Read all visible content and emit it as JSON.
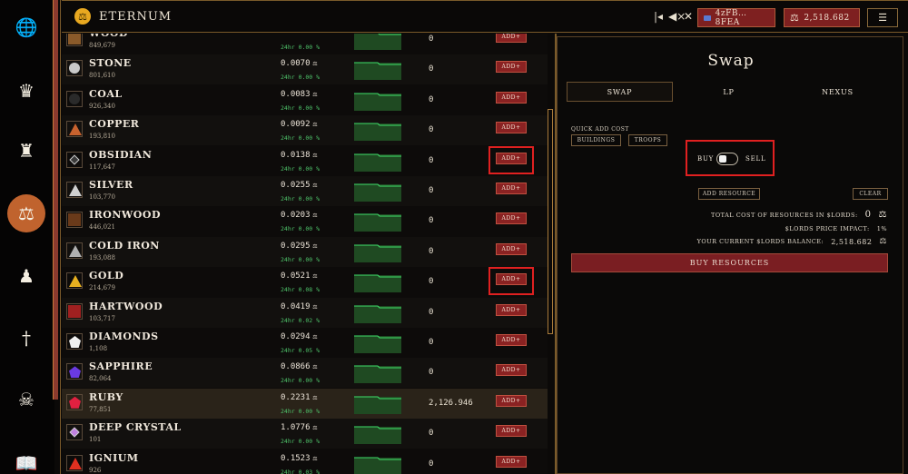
{
  "app": {
    "brand": "ETERNUM"
  },
  "topbar": {
    "back_icon": "skip-back-icon",
    "mute_icon": "mute-icon",
    "close_icon": "close-icon",
    "account": "4zFB…8FEA",
    "balance": "2,518.682"
  },
  "sidebar": {
    "items": [
      {
        "icon": "globe-icon",
        "glyph": "🌐"
      },
      {
        "icon": "crown-icon",
        "glyph": "♛"
      },
      {
        "icon": "castle-icon",
        "glyph": "♜"
      },
      {
        "icon": "scales-icon",
        "glyph": "⚖"
      },
      {
        "icon": "army-icon",
        "glyph": "♟"
      },
      {
        "icon": "sword-icon",
        "glyph": "†"
      },
      {
        "icon": "skull-icon",
        "glyph": "☠"
      },
      {
        "icon": "book-icon",
        "glyph": "📖"
      }
    ]
  },
  "resources": [
    {
      "name": "WOOD",
      "amount": "849,679",
      "price": "",
      "change": "24hr 0.00 %",
      "qty": "0",
      "color": "#8a5a2a",
      "shape": "square"
    },
    {
      "name": "STONE",
      "amount": "801,610",
      "price": "0.0070",
      "change": "24hr 0.00 %",
      "qty": "0",
      "color": "#c9c9c9",
      "shape": "circle"
    },
    {
      "name": "COAL",
      "amount": "926,340",
      "price": "0.0083",
      "change": "24hr 0.00 %",
      "qty": "0",
      "color": "#2a2a2a",
      "shape": "circle"
    },
    {
      "name": "COPPER",
      "amount": "193,810",
      "price": "0.0092",
      "change": "24hr 0.00 %",
      "qty": "0",
      "color": "#c8622e",
      "shape": "triangle"
    },
    {
      "name": "OBSIDIAN",
      "amount": "117,647",
      "price": "0.0138",
      "change": "24hr 0.00 %",
      "qty": "0",
      "color": "#3a3a3a",
      "shape": "diamond"
    },
    {
      "name": "SILVER",
      "amount": "103,770",
      "price": "0.0255",
      "change": "24hr 0.00 %",
      "qty": "0",
      "color": "#d0d0d0",
      "shape": "triangle"
    },
    {
      "name": "IRONWOOD",
      "amount": "446,021",
      "price": "0.0203",
      "change": "24hr 0.00 %",
      "qty": "0",
      "color": "#6a3a1a",
      "shape": "square"
    },
    {
      "name": "COLD IRON",
      "amount": "193,088",
      "price": "0.0295",
      "change": "24hr 0.00 %",
      "qty": "0",
      "color": "#b0b0b0",
      "shape": "triangle"
    },
    {
      "name": "GOLD",
      "amount": "214,679",
      "price": "0.0521",
      "change": "24hr 0.08 %",
      "qty": "0",
      "color": "#e8b020",
      "shape": "triangle"
    },
    {
      "name": "HARTWOOD",
      "amount": "103,717",
      "price": "0.0419",
      "change": "24hr 0.02 %",
      "qty": "0",
      "color": "#a02020",
      "shape": "square"
    },
    {
      "name": "DIAMONDS",
      "amount": "1,108",
      "price": "0.0294",
      "change": "24hr 0.05 %",
      "qty": "0",
      "color": "#f0f0f0",
      "shape": "pentagon"
    },
    {
      "name": "SAPPHIRE",
      "amount": "82,064",
      "price": "0.0866",
      "change": "24hr 0.00 %",
      "qty": "0",
      "color": "#6a3ae0",
      "shape": "gem"
    },
    {
      "name": "RUBY",
      "amount": "77,851",
      "price": "0.2231",
      "change": "24hr 0.00 %",
      "qty": "2,126.946",
      "color": "#e02040",
      "shape": "pentagon"
    },
    {
      "name": "DEEP CRYSTAL",
      "amount": "101",
      "price": "1.0776",
      "change": "24hr 0.00 %",
      "qty": "0",
      "color": "#c080e0",
      "shape": "diamond"
    },
    {
      "name": "IGNIUM",
      "amount": "926",
      "price": "0.1523",
      "change": "24hr 0.03 %",
      "qty": "0",
      "color": "#e03020",
      "shape": "triangle"
    }
  ],
  "labels": {
    "currency_symbol": "⚖",
    "add_btn": "ADD+"
  },
  "swap": {
    "title": "Swap",
    "tabs": [
      "SWAP",
      "LP",
      "NEXUS"
    ],
    "quick_add_label": "QUICK ADD COST",
    "quick_add_buttons": [
      "BUILDINGS",
      "TROOPS"
    ],
    "toggle_buy": "BUY",
    "toggle_sell": "SELL",
    "add_resource": "ADD RESOURCE",
    "clear": "CLEAR",
    "total_cost_label": "TOTAL COST OF RESOURCES IN $LORDS:",
    "total_cost_value": "0",
    "impact_label": "$LORDS PRICE IMPACT:",
    "impact_value": "1%",
    "balance_label": "YOUR CURRENT $LORDS BALANCE:",
    "balance_value": "2,518.682",
    "buy_button": "BUY RESOURCES"
  },
  "colors": {
    "accent_red": "#7e2020",
    "highlight": "#e02020",
    "positive": "#4ec36a",
    "gold": "#e8a820"
  }
}
